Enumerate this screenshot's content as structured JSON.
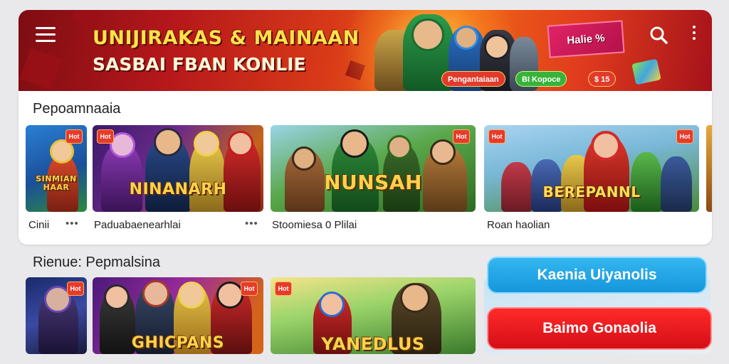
{
  "header": {
    "title": "UNIJIRAKAS & MAINAAN",
    "subtitle": "SASBAI FBAN KONLIE",
    "promo_tag": "Halie %",
    "chips": [
      "Pengantaiaan",
      "BI Kopoce",
      "$ 15"
    ],
    "icons": {
      "menu": "menu-icon",
      "search": "search-icon",
      "more": "more-vertical-icon"
    },
    "colors": {
      "primary": "#c41a1a",
      "accent": "#ffe34a"
    }
  },
  "section1": {
    "title": "Pepoamnaaia",
    "tiles": [
      {
        "logo": "SINMIAN HAAR",
        "label": "Cinii",
        "badge": "Hot"
      },
      {
        "logo": "NINANARH",
        "label": "Paduabaenearhlai",
        "badge": "Hot"
      },
      {
        "logo": "NUNSAH",
        "label": "Stoomiesa 0 Plilai",
        "badge": "Hot"
      },
      {
        "logo": "BEREPANNL",
        "label": "Roan haolian",
        "badge": "Hot"
      }
    ]
  },
  "section2": {
    "title": "Rienue: Pepmalsina",
    "tiles": [
      {
        "logo": "",
        "badge": "Hot"
      },
      {
        "logo": "GHICPANS",
        "badge": "Hot"
      },
      {
        "logo": "YANEDLUS",
        "badge": "Hot"
      }
    ],
    "cta_primary": "Kaenia Uiyanolis",
    "cta_secondary": "Baimo Gonaolia",
    "colors": {
      "cta_primary": "#1ea5e8",
      "cta_secondary": "#e8131d"
    }
  }
}
